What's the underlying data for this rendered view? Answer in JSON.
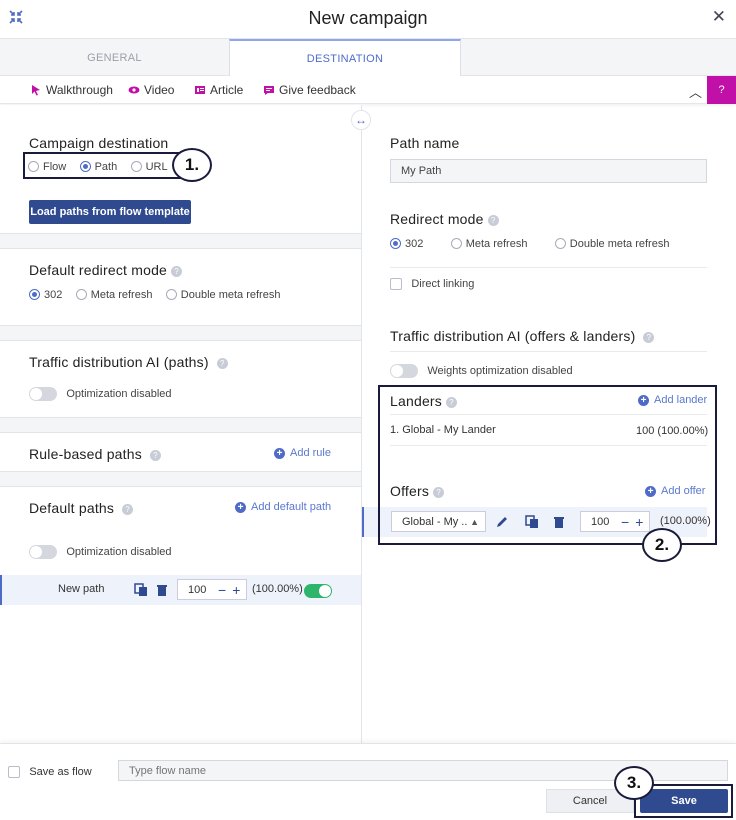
{
  "window": {
    "title": "New campaign"
  },
  "tabs": [
    {
      "label": "GENERAL",
      "active": false
    },
    {
      "label": "DESTINATION",
      "active": true
    }
  ],
  "helpbar": {
    "walkthrough": "Walkthrough",
    "video": "Video",
    "article": "Article",
    "feedback": "Give feedback",
    "accent": "#c010a8"
  },
  "left": {
    "destination": {
      "title": "Campaign destination",
      "options": [
        "Flow",
        "Path",
        "URL"
      ],
      "selected": "Path",
      "load_button": "Load paths from flow template"
    },
    "redirect": {
      "title": "Default redirect mode",
      "options": [
        "302",
        "Meta refresh",
        "Double meta refresh"
      ],
      "selected": "302"
    },
    "traffic_ai": {
      "title": "Traffic distribution AI (paths)",
      "toggle_label": "Optimization disabled"
    },
    "rule_based": {
      "title": "Rule-based paths",
      "add_label": "Add rule"
    },
    "default_paths": {
      "title": "Default paths",
      "add_label": "Add default path",
      "toggle_label": "Optimization disabled",
      "path": {
        "name": "New path",
        "weight": "100",
        "percent": "(100.00%)"
      }
    }
  },
  "right": {
    "path_name": {
      "title": "Path name",
      "value": "My Path"
    },
    "redirect": {
      "title": "Redirect mode",
      "options": [
        "302",
        "Meta refresh",
        "Double meta refresh"
      ],
      "selected": "302"
    },
    "direct_linking": "Direct linking",
    "traffic_ai": {
      "title": "Traffic distribution AI (offers & landers)",
      "toggle_label": "Weights optimization disabled"
    },
    "landers": {
      "title": "Landers",
      "add_label": "Add lander",
      "items": [
        {
          "name": "1. Global - My Lander",
          "weight": "100 (100.00%)"
        }
      ]
    },
    "offers": {
      "title": "Offers",
      "add_label": "Add offer",
      "select_value": "Global - My ..",
      "weight": "100",
      "percent": "(100.00%)"
    }
  },
  "footer": {
    "save_as_flow": "Save as flow",
    "flow_name_placeholder": "Type flow name",
    "cancel": "Cancel",
    "save": "Save"
  },
  "callouts": [
    "1.",
    "2.",
    "3."
  ]
}
